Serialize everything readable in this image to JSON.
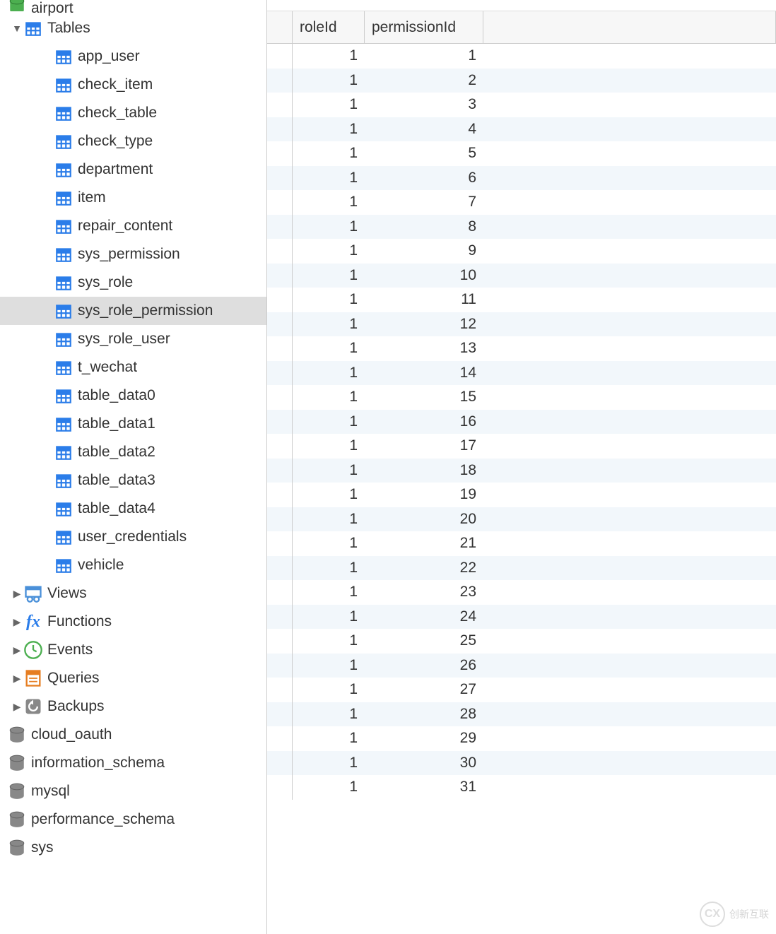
{
  "sidebar": {
    "current_db": "airport",
    "tables_label": "Tables",
    "tables": [
      "app_user",
      "check_item",
      "check_table",
      "check_type",
      "department",
      "item",
      "repair_content",
      "sys_permission",
      "sys_role",
      "sys_role_permission",
      "sys_role_user",
      "t_wechat",
      "table_data0",
      "table_data1",
      "table_data2",
      "table_data3",
      "table_data4",
      "user_credentials",
      "vehicle"
    ],
    "selected_table": "sys_role_permission",
    "folders": [
      {
        "name": "Views",
        "icon": "view"
      },
      {
        "name": "Functions",
        "icon": "func"
      },
      {
        "name": "Events",
        "icon": "event"
      },
      {
        "name": "Queries",
        "icon": "query"
      },
      {
        "name": "Backups",
        "icon": "backup"
      }
    ],
    "databases": [
      "cloud_oauth",
      "information_schema",
      "mysql",
      "performance_schema",
      "sys"
    ]
  },
  "table": {
    "columns": [
      "roleId",
      "permissionId"
    ],
    "rows": [
      [
        1,
        1
      ],
      [
        1,
        2
      ],
      [
        1,
        3
      ],
      [
        1,
        4
      ],
      [
        1,
        5
      ],
      [
        1,
        6
      ],
      [
        1,
        7
      ],
      [
        1,
        8
      ],
      [
        1,
        9
      ],
      [
        1,
        10
      ],
      [
        1,
        11
      ],
      [
        1,
        12
      ],
      [
        1,
        13
      ],
      [
        1,
        14
      ],
      [
        1,
        15
      ],
      [
        1,
        16
      ],
      [
        1,
        17
      ],
      [
        1,
        18
      ],
      [
        1,
        19
      ],
      [
        1,
        20
      ],
      [
        1,
        21
      ],
      [
        1,
        22
      ],
      [
        1,
        23
      ],
      [
        1,
        24
      ],
      [
        1,
        25
      ],
      [
        1,
        26
      ],
      [
        1,
        27
      ],
      [
        1,
        28
      ],
      [
        1,
        29
      ],
      [
        1,
        30
      ],
      [
        1,
        31
      ]
    ]
  },
  "watermark": "创新互联"
}
